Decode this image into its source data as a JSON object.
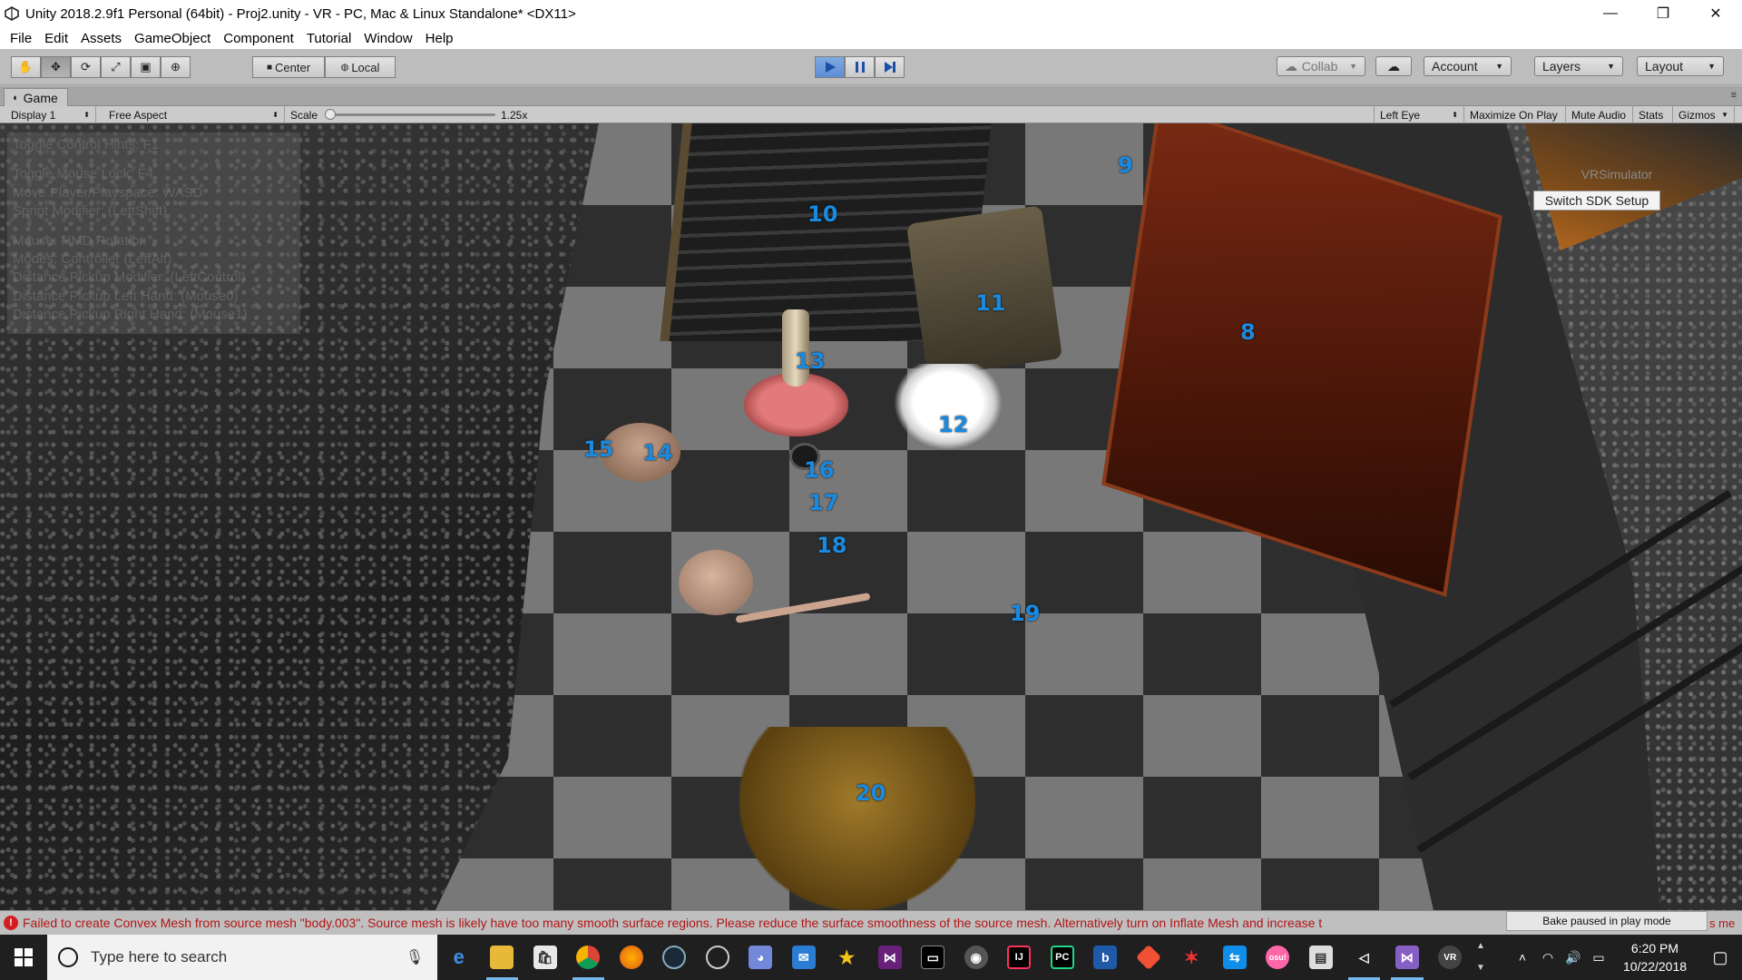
{
  "window": {
    "title": "Unity 2018.2.9f1 Personal (64bit) - Proj2.unity - VR - PC, Mac & Linux Standalone* <DX11>",
    "controls": {
      "minimize": "—",
      "restore": "❐",
      "close": "✕"
    }
  },
  "menu": [
    "File",
    "Edit",
    "Assets",
    "GameObject",
    "Component",
    "Tutorial",
    "Window",
    "Help"
  ],
  "toolbar": {
    "transform_tools": [
      "hand-tool-icon",
      "move-tool-icon",
      "rotate-tool-icon",
      "scale-tool-icon",
      "rect-tool-icon",
      "transform-tool-icon"
    ],
    "pivot_mode": "Center",
    "pivot_rotation": "Local",
    "play_state": "playing",
    "collab": "Collab",
    "account": "Account",
    "layers": "Layers",
    "layout": "Layout"
  },
  "game_tab": {
    "label": "Game"
  },
  "game_controls": {
    "display": "Display 1",
    "aspect": "Free Aspect",
    "scale_label": "Scale",
    "scale_value": "1.25x",
    "eye": "Left Eye",
    "maximize_on_play": "Maximize On Play",
    "mute_audio": "Mute Audio",
    "stats": "Stats",
    "gizmos": "Gizmos"
  },
  "hints": {
    "line1": "Toggle Control Hints: F1",
    "line2": "Toggle Mouse Lock: F4",
    "line3": "Move Player/Playspace: WASD",
    "line4": "Sprint Modifier: (LeftShift)",
    "line5": "Mouse: HMD Rotation",
    "line6": "Modes: Controller (LeftAlt)",
    "line7": "Distance Pickup Modifier: (LeftControl)",
    "line8": "Distance Pickup Left Hand: (Mouse0)",
    "line9": "Distance Pickup Right Hand: (Mouse1)"
  },
  "vr_simulator": {
    "label": "VRSimulator",
    "button": "Switch SDK Setup"
  },
  "object_labels": [
    "8",
    "9",
    "10",
    "11",
    "12",
    "13",
    "14",
    "15",
    "16",
    "17",
    "18",
    "19",
    "20"
  ],
  "status": {
    "message": "Failed to create Convex Mesh from source mesh \"body.003\". Source mesh is likely have too many smooth surface regions. Please reduce the surface smoothness of the source mesh. Alternatively turn on Inflate Mesh and increase t",
    "bake": "Bake paused in play mode",
    "tail": "s me"
  },
  "taskbar": {
    "search_placeholder": "Type here to search",
    "apps": [
      "edge-icon",
      "file-explorer-icon",
      "store-icon",
      "chrome-icon",
      "firefox-icon",
      "steam-icon",
      "unity-hub-icon",
      "discord-icon",
      "mail-icon",
      "star-icon",
      "visual-studio-icon",
      "terminal-icon",
      "game-icon",
      "intellij-icon",
      "pycharm-icon",
      "blend-icon",
      "git-icon",
      "arrow-app-icon",
      "teamviewer-icon",
      "osu-icon",
      "photo-icon",
      "unity-icon",
      "visual-studio-purple-icon",
      "vr-icon"
    ],
    "time": "6:20 PM",
    "date": "10/22/2018"
  },
  "colors": {
    "label_blue": "#1a8ae0",
    "error_red": "#d21e1e",
    "play_blue": "#5c8fd6"
  }
}
